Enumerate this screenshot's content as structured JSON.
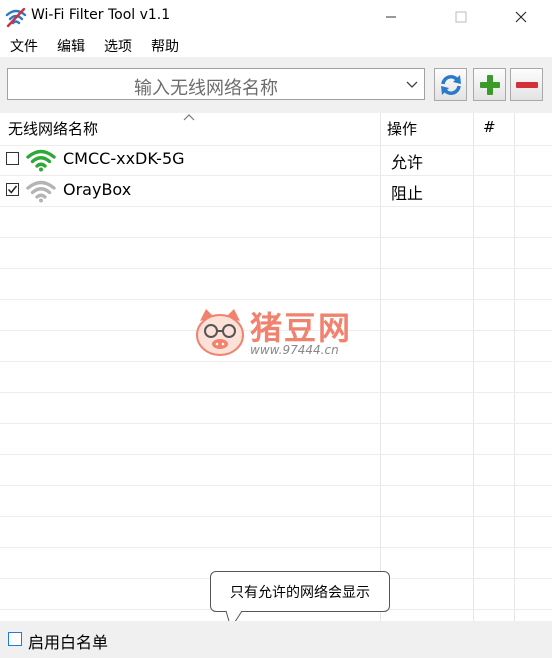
{
  "window": {
    "title": "Wi-Fi Filter Tool v1.1",
    "controls": [
      "minimize",
      "maximize",
      "close"
    ]
  },
  "menu": {
    "items": [
      "文件",
      "编辑",
      "选项",
      "帮助"
    ]
  },
  "toolbar": {
    "network_input_placeholder": "输入无线网络名称",
    "buttons": [
      "refresh-icon",
      "add-icon",
      "remove-icon"
    ]
  },
  "table": {
    "columns": [
      "无线网络名称",
      "操作",
      "#"
    ],
    "rows": [
      {
        "checked": false,
        "signal": "strong",
        "name": "CMCC-xxDK-5G",
        "action": "允许"
      },
      {
        "checked": true,
        "signal": "weak",
        "name": "OrayBox",
        "action": "阻止"
      }
    ]
  },
  "watermark": {
    "title": "猪豆网",
    "url": "www.97444.cn"
  },
  "tooltip": {
    "text": "只有允许的网络会显示"
  },
  "footer": {
    "whitelist_checked": false,
    "whitelist_label": "启用白名单"
  },
  "colors": {
    "wifi_strong": "#2ea836",
    "wifi_weak": "#b4b4b4",
    "refresh_blue": "#2b79c9",
    "add_green": "#3a9a2a",
    "remove_red": "#d3303a",
    "watermark": "#f0826e"
  }
}
